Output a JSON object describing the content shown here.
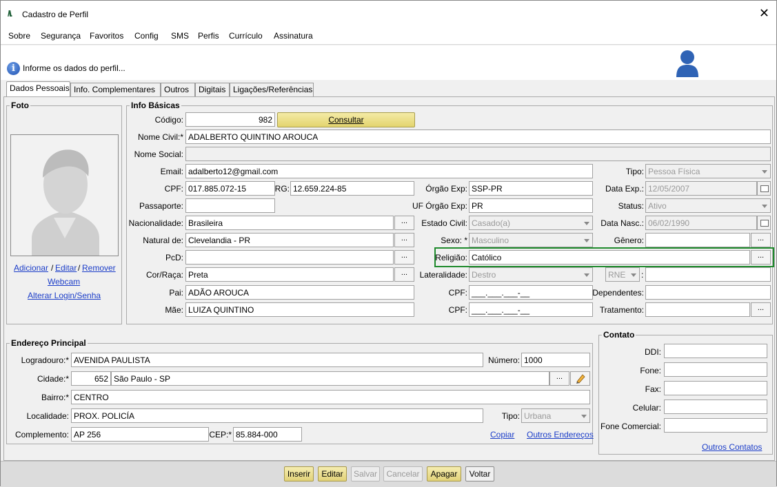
{
  "window": {
    "title": "Cadastro de Perfil",
    "close": "✕"
  },
  "menu": [
    "Sobre",
    "Segurança",
    "Favoritos",
    "Config",
    "SMS",
    "Perfis",
    "Currículo",
    "Assinatura"
  ],
  "info_message": "Informe os dados do perfil...",
  "tabs": [
    "Dados Pessoais",
    "Info. Complementares",
    "Outros",
    "Digitais",
    "Ligações/Referências"
  ],
  "foto": {
    "legend": "Foto",
    "adicionar": "Adicionar",
    "sep1": "/",
    "editar": "Editar",
    "sep2": "/",
    "remover": "Remover",
    "webcam": "Webcam",
    "alterar_login": "Alterar Login/Senha"
  },
  "info_basicas": {
    "legend": "Info Básicas",
    "codigo_label": "Código:",
    "codigo": "982",
    "consultar": "Consultar",
    "nome_civil_label": "Nome Civil:*",
    "nome_civil": "ADALBERTO QUINTINO AROUCA",
    "nome_social_label": "Nome Social:",
    "nome_social": "",
    "email_label": "Email:",
    "email": "adalberto12@gmail.com",
    "tipo_label": "Tipo:",
    "tipo": "Pessoa Física",
    "cpf_label": "CPF:",
    "cpf": "017.885.072-15",
    "rg_label": "RG:",
    "rg": "12.659.224-85",
    "orgao_exp_label": "Órgão Exp:",
    "orgao_exp": "SSP-PR",
    "data_exp_label": "Data Exp.:",
    "data_exp": "12/05/2007",
    "passaporte_label": "Passaporte:",
    "passaporte": "",
    "uf_orgao_label": "UF Órgão Exp:",
    "uf_orgao": "PR",
    "status_label": "Status:",
    "status": "Ativo",
    "nacionalidade_label": "Nacionalidade:",
    "nacionalidade": "Brasileira",
    "estado_civil_label": "Estado Civil:",
    "estado_civil": "Casado(a)",
    "data_nasc_label": "Data Nasc.:",
    "data_nasc": "06/02/1990",
    "natural_label": "Natural de:",
    "natural": "Clevelandia - PR",
    "sexo_label": "Sexo: *",
    "sexo": "Masculino",
    "genero_label": "Gênero:",
    "genero": "",
    "pcd_label": "PcD:",
    "pcd": "",
    "religiao_label": "Religião:",
    "religiao": "Católico",
    "cor_label": "Cor/Raça:",
    "cor": "Preta",
    "lateralidade_label": "Lateralidade:",
    "lateralidade": "Destro",
    "rne": "RNE",
    "rne_colon": ":",
    "rne_value": "",
    "pai_label": "Pai:",
    "pai": "ADÃO AROUCA",
    "cpf_pai_label": "CPF:",
    "cpf_pai": "___.___.___-__",
    "dependentes_label": "Dependentes:",
    "dependentes": "",
    "mae_label": "Mãe:",
    "mae": "LUIZA QUINTINO",
    "cpf_mae_label": "CPF:",
    "cpf_mae": "___.___.___-__",
    "tratamento_label": "Tratamento:",
    "tratamento": "",
    "dots": "..."
  },
  "endereco": {
    "legend": "Endereço Principal",
    "logradouro_label": "Logradouro:*",
    "logradouro": "AVENIDA PAULISTA",
    "numero_label": "Número:",
    "numero": "1000",
    "cidade_label": "Cidade:*",
    "cidade_codigo": "652",
    "cidade": "São Paulo - SP",
    "bairro_label": "Bairro:*",
    "bairro": "CENTRO",
    "localidade_label": "Localidade:",
    "localidade": "PROX. POLICÍA",
    "tipo_label": "Tipo:",
    "tipo": "Urbana",
    "complemento_label": "Complemento:",
    "complemento": "AP 256",
    "cep_label": "CEP:*",
    "cep": "85.884-000",
    "copiar": "Copiar",
    "outros_enderecos": "Outros Endereços"
  },
  "contato": {
    "legend": "Contato",
    "ddi_label": "DDI:",
    "fone_label": "Fone:",
    "fax_label": "Fax:",
    "celular_label": "Celular:",
    "fone_comercial_label": "Fone Comercial:",
    "outros_contatos": "Outros Contatos"
  },
  "buttons": {
    "inserir": "Inserir",
    "editar": "Editar",
    "salvar": "Salvar",
    "cancelar": "Cancelar",
    "apagar": "Apagar",
    "voltar": "Voltar"
  },
  "colors": {
    "highlight": "#1e8a2c",
    "link": "#1a3cc8",
    "consult_btn": "#e9dc85"
  }
}
